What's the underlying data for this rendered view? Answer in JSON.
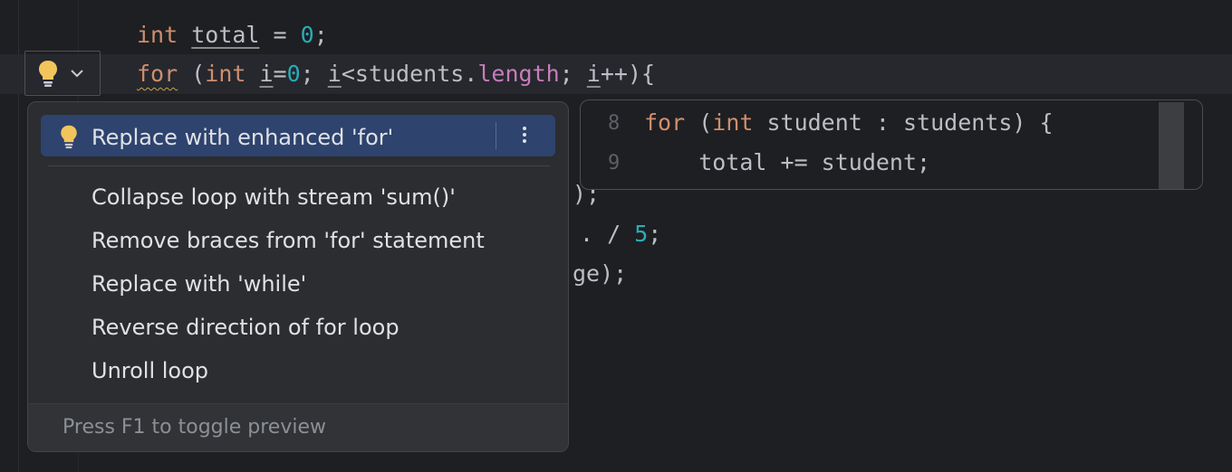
{
  "editor": {
    "line1": {
      "kw": "int",
      "var": "total",
      "rest": " = ",
      "num": "0",
      "end": ";"
    },
    "line2": {
      "kw_for": "for",
      "p1": " (",
      "kw_int": "int",
      "sp": " ",
      "i1": "i",
      "eq": "=",
      "zero": "0",
      "semi1": "; ",
      "i2": "i",
      "lt": "<students.",
      "length": "length",
      "semi2": "; ",
      "i3": "i",
      "tail": "++){"
    },
    "line4_fragment": ");",
    "line5_fragment": {
      "dots": ". / ",
      "num": "5",
      "end": ";"
    },
    "line6_fragment": "ge);"
  },
  "intention_popup": {
    "selected_label": "Replace with enhanced 'for'",
    "items": [
      "Collapse loop with stream 'sum()'",
      "Remove braces from 'for' statement",
      "Replace with 'while'",
      "Reverse direction of for loop",
      "Unroll loop"
    ],
    "footer_hint": "Press F1 to toggle preview"
  },
  "preview": {
    "lines": [
      {
        "number": "8",
        "kw_for": "for",
        "p1": " (",
        "kw_int": "int",
        "rest": " student : students) {"
      },
      {
        "number": "9",
        "code": "    total += student;"
      }
    ]
  },
  "icons": {
    "bulb": "lightbulb-icon",
    "chevron": "chevron-down-icon",
    "more": "more-vertical-icon"
  },
  "colors": {
    "background": "#1e1f22",
    "keyword": "#cf8e6d",
    "number": "#2aacb8",
    "field": "#c77dbb",
    "selection": "#2e436e",
    "bulb": "#f2c55c"
  }
}
